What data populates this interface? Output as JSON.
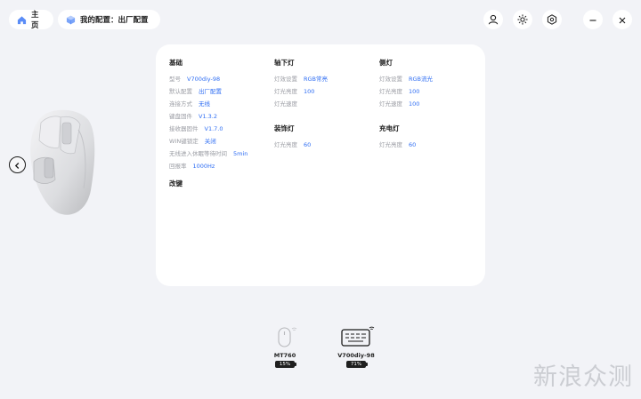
{
  "nav": {
    "home_label": "主页",
    "config_label": "我的配置：出厂配置"
  },
  "icons": {
    "home": "home-icon",
    "cube": "cube-icon",
    "user": "user-icon",
    "brightness": "sun-icon",
    "settings": "hexagon-settings-icon",
    "minimize": "minimize-icon",
    "close": "close-icon",
    "back": "chevron-left-icon"
  },
  "colors": {
    "accent": "#2f6ef3",
    "nav_icon": "#5b8df7"
  },
  "basic": {
    "title": "基础",
    "rows": [
      {
        "key": "型号",
        "value": "V700diy-98"
      },
      {
        "key": "默认配置",
        "value": "出厂配置"
      },
      {
        "key": "连接方式",
        "value": "无线"
      },
      {
        "key": "键盘固件",
        "value": "V1.3.2"
      },
      {
        "key": "接收器固件",
        "value": "V1.7.0"
      },
      {
        "key": "WIN键锁定",
        "value": "关闭"
      },
      {
        "key": "无线进入休眠等待时间",
        "value": "5min"
      },
      {
        "key": "回报率",
        "value": "1000Hz"
      }
    ]
  },
  "remap": {
    "title": "改键"
  },
  "under_light": {
    "title": "轴下灯",
    "rows": [
      {
        "key": "灯效设置",
        "value": "RGB常亮"
      },
      {
        "key": "灯光亮度",
        "value": "100"
      },
      {
        "key": "灯光速度",
        "value": ""
      }
    ]
  },
  "side_light": {
    "title": "侧灯",
    "rows": [
      {
        "key": "灯效设置",
        "value": "RGB流光"
      },
      {
        "key": "灯光亮度",
        "value": "100"
      },
      {
        "key": "灯光速度",
        "value": "100"
      }
    ]
  },
  "deco_light": {
    "title": "装饰灯",
    "rows": [
      {
        "key": "灯光亮度",
        "value": "60"
      }
    ]
  },
  "charge_light": {
    "title": "充电灯",
    "rows": [
      {
        "key": "灯光亮度",
        "value": "60"
      }
    ]
  },
  "devices": [
    {
      "name": "MT760",
      "battery": "15%",
      "icon": "mouse-icon"
    },
    {
      "name": "V700diy-98",
      "battery": "71%",
      "icon": "keyboard-icon"
    }
  ],
  "watermark": "新浪众测"
}
